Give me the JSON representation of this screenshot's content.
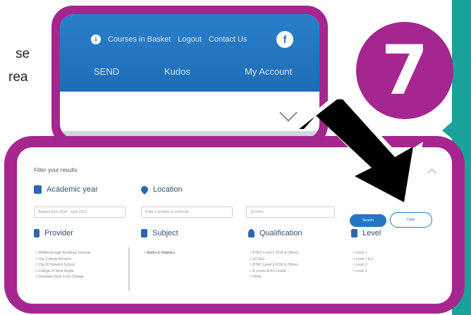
{
  "background_text": {
    "line1": "se",
    "line2": "rea"
  },
  "badge": {
    "number": "7"
  },
  "site_header": {
    "top_links": [
      "Courses in Basket",
      "Logout",
      "Contact Us"
    ],
    "facebook_glyph": "f",
    "nav": [
      "SEND",
      "Kudos",
      "My Account"
    ]
  },
  "filter": {
    "title": "Filter your results",
    "academic_year": {
      "label": "Academic year",
      "value": "Autumn term 2018 - June 2019"
    },
    "location": {
      "label": "Location",
      "placeholder": "Enter a location or postcode",
      "radius": "10 miles"
    },
    "search_label": "Search",
    "clear_label": "Clear",
    "provider": {
      "label": "Provider",
      "items": [
        "Middlesbrough Academy Schools",
        "City College Norwich",
        "City Of Norwich School",
        "College of West Anglia",
        "Dereham Sixth Form College"
      ]
    },
    "subject": {
      "label": "Subject",
      "items": [
        "Maths & Statistics"
      ]
    },
    "qualification": {
      "label": "Qualification",
      "items": [
        "BTEC Level 2 OCR & Others",
        "GCSEs",
        "BTEC Level 3 OCR & Others",
        "A Levels & AS Levels",
        "Other"
      ]
    },
    "level": {
      "label": "Level",
      "items": [
        "Level 1",
        "Level 1 & 2",
        "Level 2",
        "Level 3"
      ]
    }
  },
  "colors": {
    "callout": "#a6268f",
    "brand_blue": "#2477c4",
    "teal": "#1aa39a"
  }
}
